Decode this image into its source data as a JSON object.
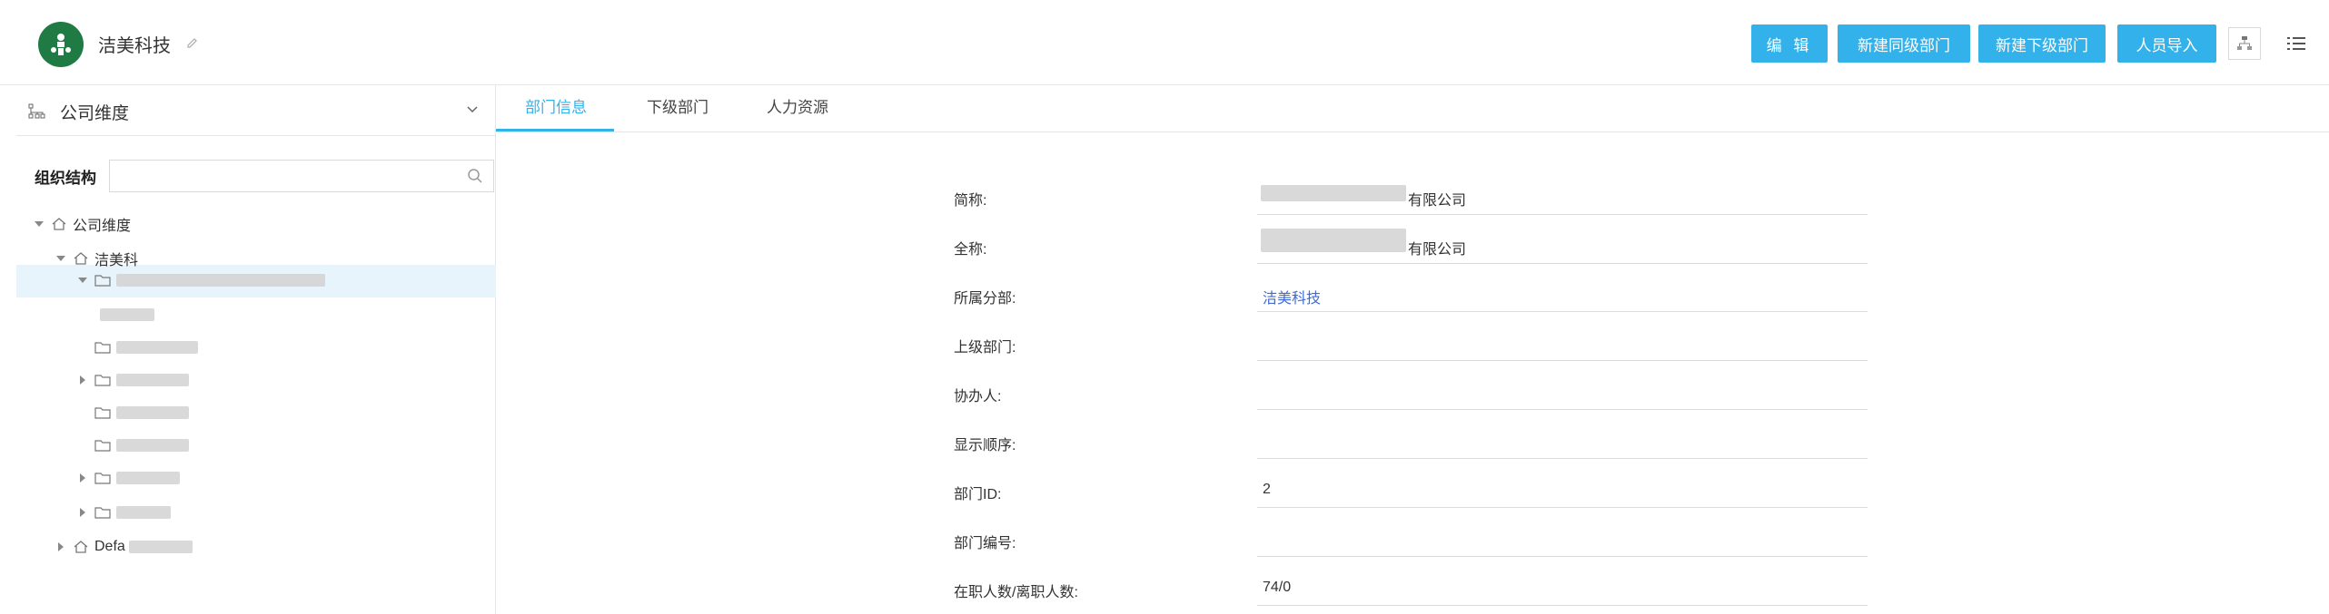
{
  "header": {
    "company_name": "洁美科技",
    "buttons": {
      "edit": "编 辑",
      "new_sibling": "新建同级部门",
      "new_child": "新建下级部门",
      "import_people": "人员导入"
    }
  },
  "sidebar": {
    "dimension_label": "公司维度",
    "org_label": "组织结构",
    "search_placeholder": "",
    "tree": {
      "root": "公司维度",
      "company": "洁美科",
      "default": "Defa"
    }
  },
  "tabs": {
    "dept_info": "部门信息",
    "sub_dept": "下级部门",
    "hr": "人力资源"
  },
  "form": {
    "short_name": {
      "label": "简称:",
      "value": "有限公司"
    },
    "full_name": {
      "label": "全称:",
      "value": "有限公司"
    },
    "branch": {
      "label": "所属分部:",
      "value": "洁美科技"
    },
    "parent_dept": {
      "label": "上级部门:",
      "value": ""
    },
    "assistant": {
      "label": "协办人:",
      "value": ""
    },
    "display_order": {
      "label": "显示顺序:",
      "value": ""
    },
    "dept_id": {
      "label": "部门ID:",
      "value": "2"
    },
    "dept_code": {
      "label": "部门编号:",
      "value": ""
    },
    "headcount": {
      "label": "在职人数/离职人数:",
      "value": "74/0"
    }
  },
  "colors": {
    "accent": "#33b1ea",
    "logo": "#1f7a43",
    "link": "#3f6bd6",
    "selected_row": "#e8f4fc"
  }
}
